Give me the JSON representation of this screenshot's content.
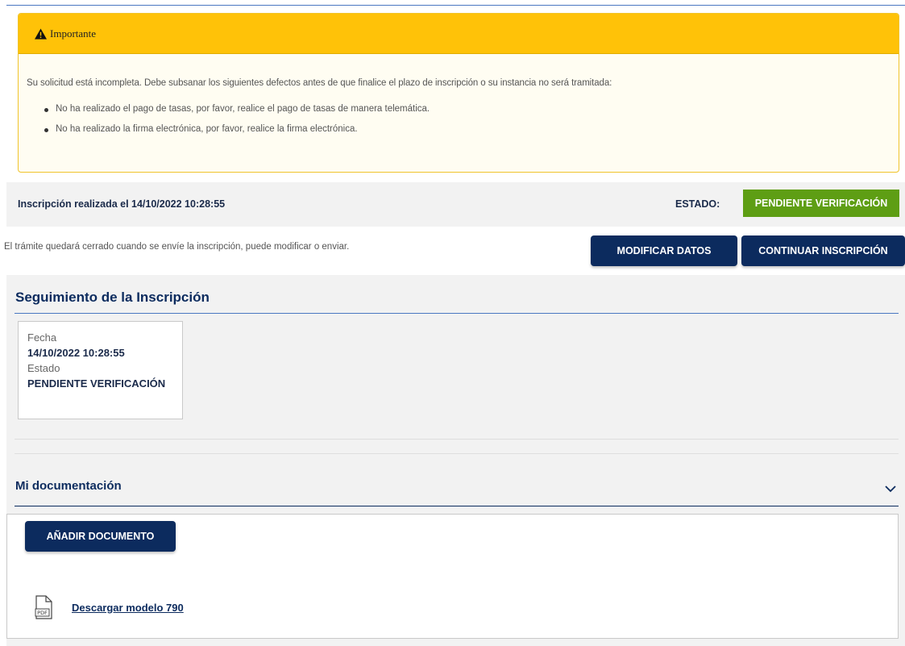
{
  "alert": {
    "title": "Importante",
    "message": "Su solicitud está incompleta. Debe subsanar los siguientes defectos antes de que finalice el plazo de inscripción o su instancia no será tramitada:",
    "items": [
      "No ha realizado el pago de tasas, por favor, realice el pago de tasas de manera telemática.",
      "No ha realizado la firma electrónica, por favor, realice la firma electrónica."
    ]
  },
  "status": {
    "registration_text": "Inscripción realizada el 14/10/2022 10:28:55",
    "label": "ESTADO:",
    "badge": "PENDIENTE VERIFICACIÓN"
  },
  "actions": {
    "info": "El trámite quedará cerrado cuando se envíe la inscripción, puede modificar o enviar.",
    "modify_label": "MODIFICAR DATOS",
    "continue_label": "CONTINUAR INSCRIPCIÓN"
  },
  "tracking": {
    "title": "Seguimiento de la Inscripción",
    "date_label": "Fecha",
    "date_value": "14/10/2022 10:28:55",
    "state_label": "Estado",
    "state_value": "PENDIENTE VERIFICACIÓN"
  },
  "documentation": {
    "title": "Mi documentación",
    "add_label": "AÑADIR DOCUMENTO",
    "download_label": "Descargar modelo 790",
    "pdf_icon_text": "PDF"
  },
  "colors": {
    "navy": "#0c2b5e",
    "alert_yellow": "#ffc208",
    "status_green": "#5e9e14",
    "panel_gray": "#f2f2f2"
  },
  "icons": [
    "warning-icon",
    "chevron-down-icon",
    "pdf-file-icon"
  ]
}
